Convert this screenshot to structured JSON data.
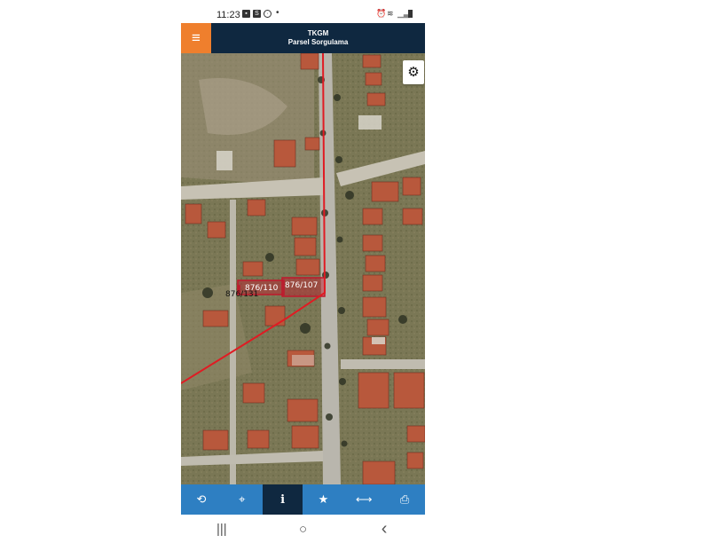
{
  "status_bar": {
    "time": "11:23",
    "left_icons": [
      "image-icon",
      "s-app-icon",
      "whatsapp-icon",
      "dot-icon"
    ],
    "right_icons": [
      "alarm-icon",
      "wifi-icon",
      "signal-icon",
      "battery-icon"
    ]
  },
  "app_bar": {
    "menu_icon": "hamburger-menu-icon",
    "title": "TKGM",
    "subtitle": "Parsel Sorgulama",
    "brand_color": "#0f2840",
    "menu_color": "#ef7f2d"
  },
  "map": {
    "settings_icon": "gear-icon",
    "parcel_highlight_color": "#c0182c",
    "parcels": [
      {
        "label": "876/110"
      },
      {
        "label": "876/107"
      },
      {
        "label": "876/131"
      }
    ]
  },
  "toolbar": {
    "color": "#2e7fc2",
    "buttons": [
      {
        "name": "refresh",
        "icon": "refresh-icon",
        "glyph": "⟲"
      },
      {
        "name": "locate",
        "icon": "crosshair-icon",
        "glyph": "⌖"
      },
      {
        "name": "info",
        "icon": "info-icon",
        "glyph": "i",
        "active": true
      },
      {
        "name": "favorites",
        "icon": "star-icon",
        "glyph": "★"
      },
      {
        "name": "measure",
        "icon": "measure-icon",
        "glyph": "⟷"
      },
      {
        "name": "print",
        "icon": "print-icon",
        "glyph": "⎙"
      }
    ]
  },
  "nav_bar": {
    "recents": "|||",
    "home": "○",
    "back": "‹"
  }
}
